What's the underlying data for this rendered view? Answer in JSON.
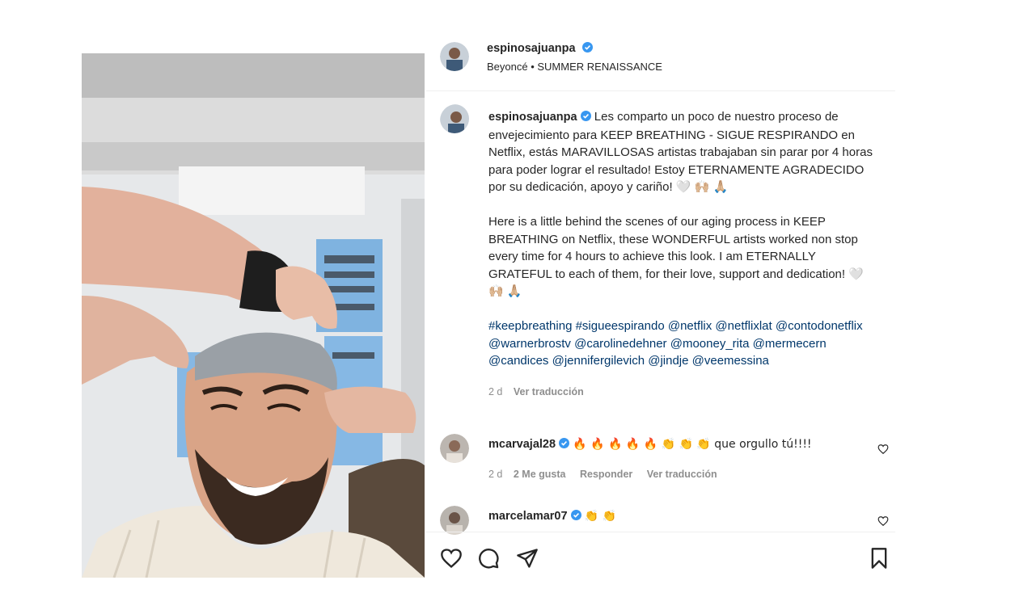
{
  "post": {
    "author": "espinosajuanpa",
    "audio": "Beyoncé • SUMMER RENAISSANCE"
  },
  "caption": {
    "author": "espinosajuanpa",
    "para1": "Les comparto un poco de nuestro proceso de envejecimiento para KEEP BREATHING - SIGUE RESPIRANDO en Netflix, estás MARAVILLOSAS artistas trabajaban sin parar por 4 horas para poder lograr el resultado! Estoy ETERNAMENTE AGRADECIDO por su dedicación, apoyo y cariño! 🤍 🙌🏼 🙏🏼",
    "para2": "Here is a little behind the scenes of our aging process in KEEP BREATHING on Netflix, these WONDERFUL artists worked non stop every time for 4 hours to achieve this look. I am ETERNALLY GRATEFUL to each of them, for their love, support and dedication! 🤍 🙌🏼 🙏🏼",
    "hashtags": "#keepbreathing #sigueespirando @netflix @netflixlat @contodonetflix @warnerbrostv @carolinedehner @mooney_rita @mermecern @candices @jennifergilevich @jindje @veemessina",
    "age": "2 d",
    "translate": "Ver traducción"
  },
  "comments": [
    {
      "user": "mcarvajal28",
      "text": "🔥 🔥 🔥 🔥 🔥 👏 👏 👏 que orgullo tú!!!!",
      "age": "2 d",
      "likes": "2 Me gusta",
      "reply": "Responder",
      "translate": "Ver traducción"
    },
    {
      "user": "marcelamar07",
      "text": "👏 👏"
    }
  ],
  "icons": [
    "verified-icon",
    "heart-icon",
    "comment-icon",
    "share-icon",
    "bookmark-icon"
  ],
  "colors": {
    "verified": "#3897f0",
    "link": "#00376b",
    "muted": "#8e8e8e"
  }
}
